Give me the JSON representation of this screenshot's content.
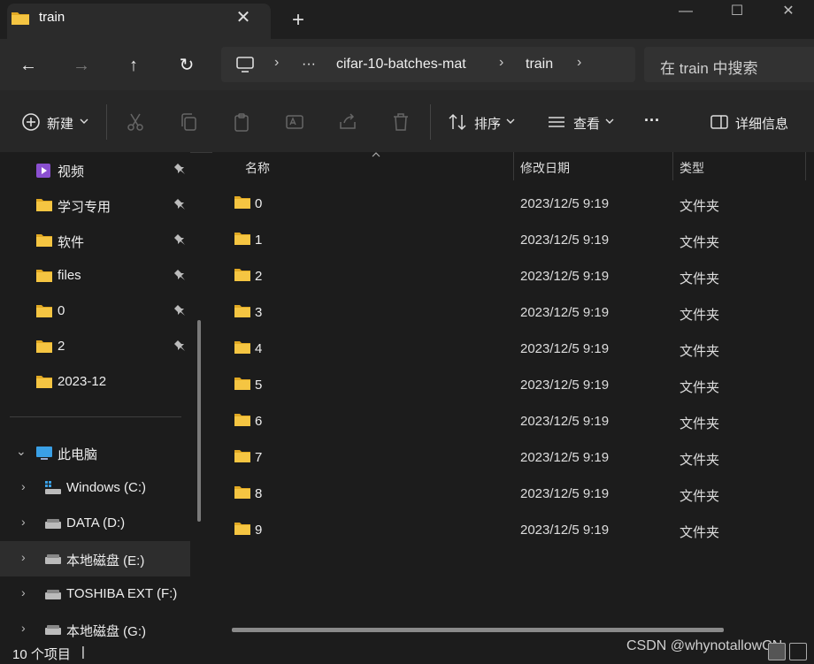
{
  "tab": {
    "title": "train",
    "close_glyph": "✕",
    "new_tab_glyph": "+"
  },
  "window": {
    "minimize_glyph": "—",
    "maximize_glyph": "☐",
    "close_glyph": "✕"
  },
  "nav": {
    "back_glyph": "←",
    "forward_glyph": "→",
    "up_glyph": "↑",
    "refresh_glyph": "↻"
  },
  "breadcrumb": {
    "more": "···",
    "items": [
      "cifar-10-batches-mat",
      "train"
    ],
    "sep": "›"
  },
  "search": {
    "placeholder": "在 train 中搜索"
  },
  "toolbar": {
    "new_label": "新建",
    "sort_label": "排序",
    "view_label": "查看",
    "more_glyph": "···",
    "details_label": "详细信息"
  },
  "sidebar": {
    "quick": [
      {
        "label": "视频",
        "icon": "video-folder-icon",
        "pinned": true
      },
      {
        "label": "学习专用",
        "icon": "folder-icon",
        "pinned": true
      },
      {
        "label": "软件",
        "icon": "folder-icon",
        "pinned": true
      },
      {
        "label": "files",
        "icon": "folder-icon",
        "pinned": true
      },
      {
        "label": "0",
        "icon": "folder-icon",
        "pinned": true
      },
      {
        "label": "2",
        "icon": "folder-icon",
        "pinned": true
      },
      {
        "label": "2023-12",
        "icon": "folder-icon",
        "pinned": false
      }
    ],
    "this_pc": {
      "label": "此电脑",
      "chevron": "⌄"
    },
    "drives": [
      {
        "label": "Windows (C:)",
        "icon": "windows-drive-icon"
      },
      {
        "label": "DATA (D:)",
        "icon": "drive-icon"
      },
      {
        "label": "本地磁盘 (E:)",
        "icon": "drive-icon",
        "selected": true
      },
      {
        "label": "TOSHIBA EXT (F:)",
        "icon": "drive-icon"
      },
      {
        "label": "本地磁盘 (G:)",
        "icon": "drive-icon"
      }
    ],
    "drive_chevron": "›"
  },
  "columns": {
    "name": "名称",
    "modified": "修改日期",
    "type": "类型"
  },
  "files": [
    {
      "name": "0",
      "modified": "2023/12/5 9:19",
      "type": "文件夹"
    },
    {
      "name": "1",
      "modified": "2023/12/5 9:19",
      "type": "文件夹"
    },
    {
      "name": "2",
      "modified": "2023/12/5 9:19",
      "type": "文件夹"
    },
    {
      "name": "3",
      "modified": "2023/12/5 9:19",
      "type": "文件夹"
    },
    {
      "name": "4",
      "modified": "2023/12/5 9:19",
      "type": "文件夹"
    },
    {
      "name": "5",
      "modified": "2023/12/5 9:19",
      "type": "文件夹"
    },
    {
      "name": "6",
      "modified": "2023/12/5 9:19",
      "type": "文件夹"
    },
    {
      "name": "7",
      "modified": "2023/12/5 9:19",
      "type": "文件夹"
    },
    {
      "name": "8",
      "modified": "2023/12/5 9:19",
      "type": "文件夹"
    },
    {
      "name": "9",
      "modified": "2023/12/5 9:19",
      "type": "文件夹"
    }
  ],
  "status": {
    "count": "10 个项目",
    "sep": "|"
  },
  "watermark": "CSDN @whynotallowCN",
  "colors": {
    "folder": "#f5c542",
    "folder_dark": "#e0a823",
    "accent": "#4aa3ff",
    "selected": "#2d2d2d"
  }
}
